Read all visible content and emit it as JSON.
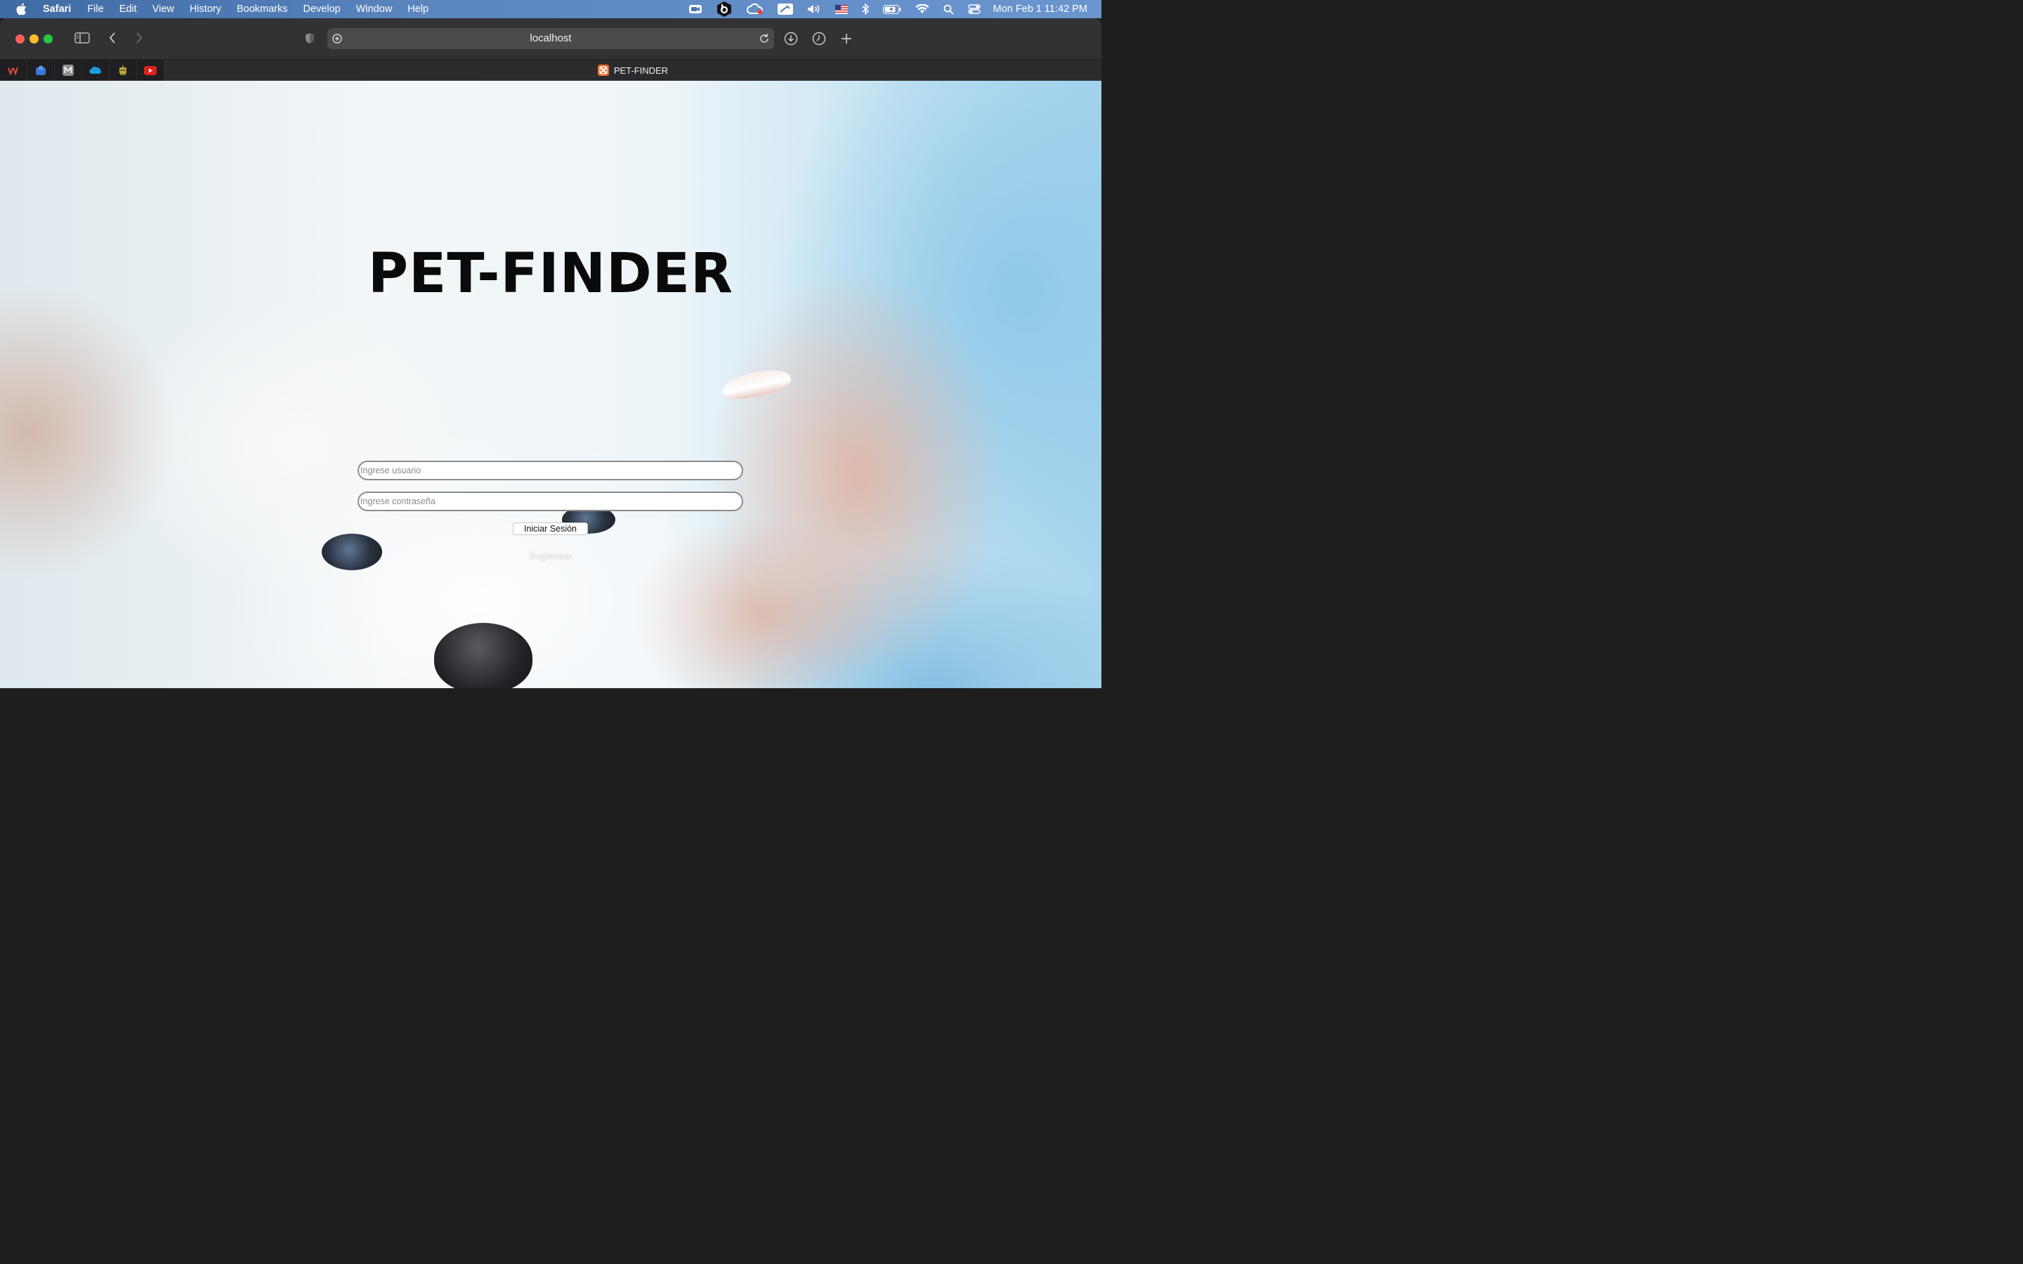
{
  "menubar": {
    "app_name": "Safari",
    "items": [
      "File",
      "Edit",
      "View",
      "History",
      "Bookmarks",
      "Develop",
      "Window",
      "Help"
    ],
    "clock": "Mon Feb 1  11:42 PM",
    "status_icons": [
      "zoom-icon",
      "bitdefender-icon",
      "creative-cloud-icon",
      "screens-icon",
      "volume-icon",
      "us-flag-icon",
      "bluetooth-icon",
      "battery-icon",
      "wifi-icon",
      "spotlight-icon",
      "control-center-icon"
    ]
  },
  "toolbar": {
    "url": "localhost"
  },
  "tabs": {
    "pinned_icons": [
      "u-icon",
      "blue-app-icon",
      "m-icon",
      "salesforce-icon",
      "robot-icon",
      "youtube-icon"
    ],
    "active_title": "PET-FINDER"
  },
  "page": {
    "title": "PET-FINDER",
    "username_placeholder": "Ingrese usuario",
    "password_placeholder": "Ingrese contraseña",
    "login_button": "Iniciar Sesión",
    "register_link": "Registrarse"
  }
}
